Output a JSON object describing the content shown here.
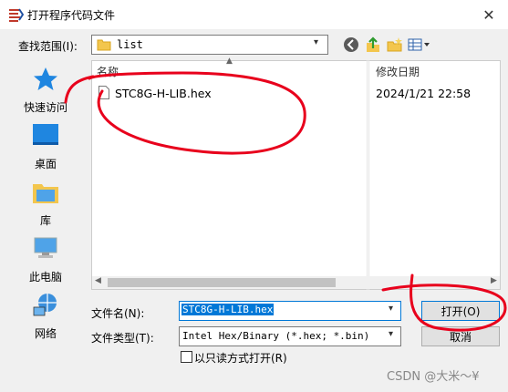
{
  "window": {
    "title": "打开程序代码文件",
    "close_glyph": "✕"
  },
  "toolbar": {
    "lookin_label": "查找范围(I):",
    "lookin_value": "list"
  },
  "places": [
    {
      "label": "快速访问",
      "icon": "star-icon"
    },
    {
      "label": "桌面",
      "icon": "desktop-icon"
    },
    {
      "label": "库",
      "icon": "library-icon"
    },
    {
      "label": "此电脑",
      "icon": "computer-icon"
    },
    {
      "label": "网络",
      "icon": "network-icon"
    }
  ],
  "filelist": {
    "columns": {
      "name": "名称",
      "date": "修改日期"
    },
    "rows": [
      {
        "name": "STC8G-H-LIB.hex",
        "date": "2024/1/21 22:58"
      }
    ]
  },
  "fields": {
    "filename_label": "文件名(N):",
    "filename_value": "STC8G-H-LIB.hex",
    "filetype_label": "文件类型(T):",
    "filetype_value": "Intel Hex/Binary (*.hex; *.bin)",
    "readonly_label": "以只读方式打开(R)"
  },
  "buttons": {
    "open": "打开(O)",
    "cancel": "取消"
  },
  "watermark": "CSDN @大米～¥",
  "colors": {
    "accent": "#0078d7",
    "annotation": "#e8001c"
  }
}
